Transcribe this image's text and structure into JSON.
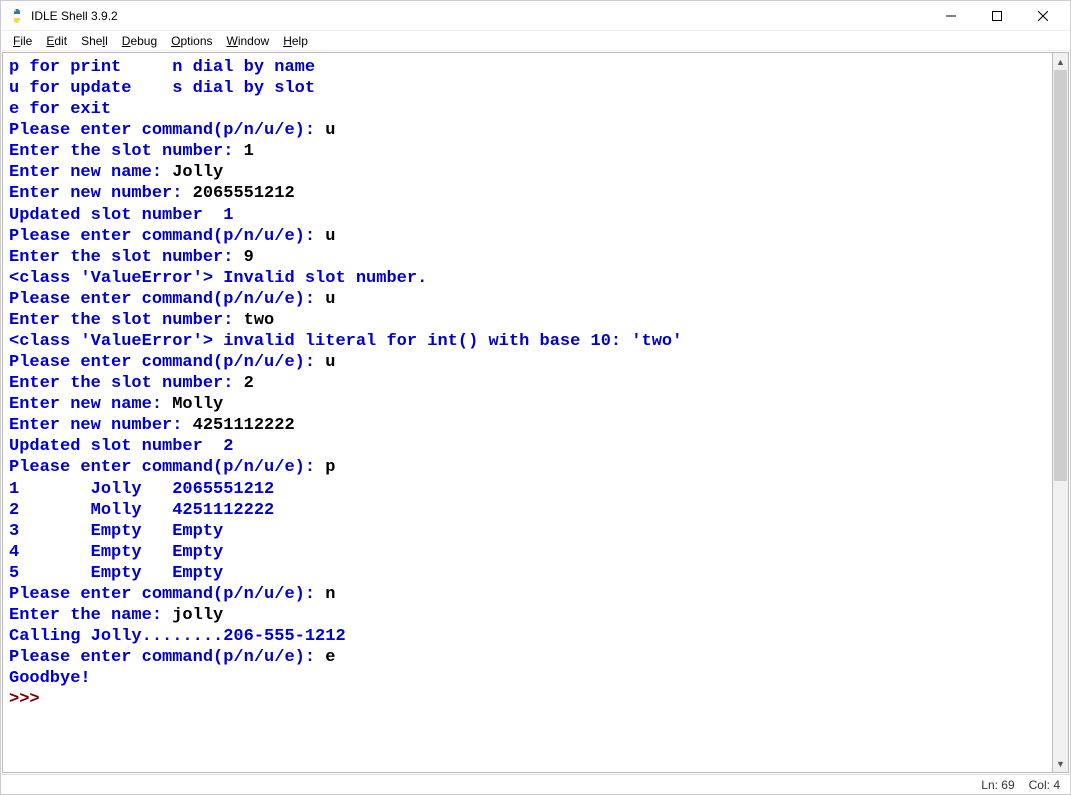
{
  "window": {
    "title": "IDLE Shell 3.9.2"
  },
  "menu": {
    "file": "File",
    "edit": "Edit",
    "shell": "Shell",
    "debug": "Debug",
    "options": "Options",
    "window": "Window",
    "help": "Help"
  },
  "shell": {
    "line1": "p for print     n dial by name",
    "line2": "u for update    s dial by slot",
    "line3": "e for exit",
    "line4a": "Please enter command(p/n/u/e): ",
    "line4b": "u",
    "line5a": "Enter the slot number: ",
    "line5b": "1",
    "line6a": "Enter new name: ",
    "line6b": "Jolly",
    "line7a": "Enter new number: ",
    "line7b": "2065551212",
    "line8": "Updated slot number  1",
    "line9a": "Please enter command(p/n/u/e): ",
    "line9b": "u",
    "line10a": "Enter the slot number: ",
    "line10b": "9",
    "line11": "<class 'ValueError'> Invalid slot number.",
    "line12a": "Please enter command(p/n/u/e): ",
    "line12b": "u",
    "line13a": "Enter the slot number: ",
    "line13b": "two",
    "line14": "<class 'ValueError'> invalid literal for int() with base 10: 'two'",
    "line15a": "Please enter command(p/n/u/e): ",
    "line15b": "u",
    "line16a": "Enter the slot number: ",
    "line16b": "2",
    "line17a": "Enter new name: ",
    "line17b": "Molly",
    "line18a": "Enter new number: ",
    "line18b": "4251112222",
    "line19": "Updated slot number  2",
    "line20a": "Please enter command(p/n/u/e): ",
    "line20b": "p",
    "line21": "1       Jolly   2065551212",
    "line22": "2       Molly   4251112222",
    "line23": "3       Empty   Empty",
    "line24": "4       Empty   Empty",
    "line25": "5       Empty   Empty",
    "line26a": "Please enter command(p/n/u/e): ",
    "line26b": "n",
    "line27a": "Enter the name: ",
    "line27b": "jolly",
    "line28": "Calling Jolly........206-555-1212",
    "line29a": "Please enter command(p/n/u/e): ",
    "line29b": "e",
    "line30": "Goodbye!",
    "prompt": ">>> "
  },
  "status": {
    "ln": "Ln: 69",
    "col": "Col: 4"
  }
}
